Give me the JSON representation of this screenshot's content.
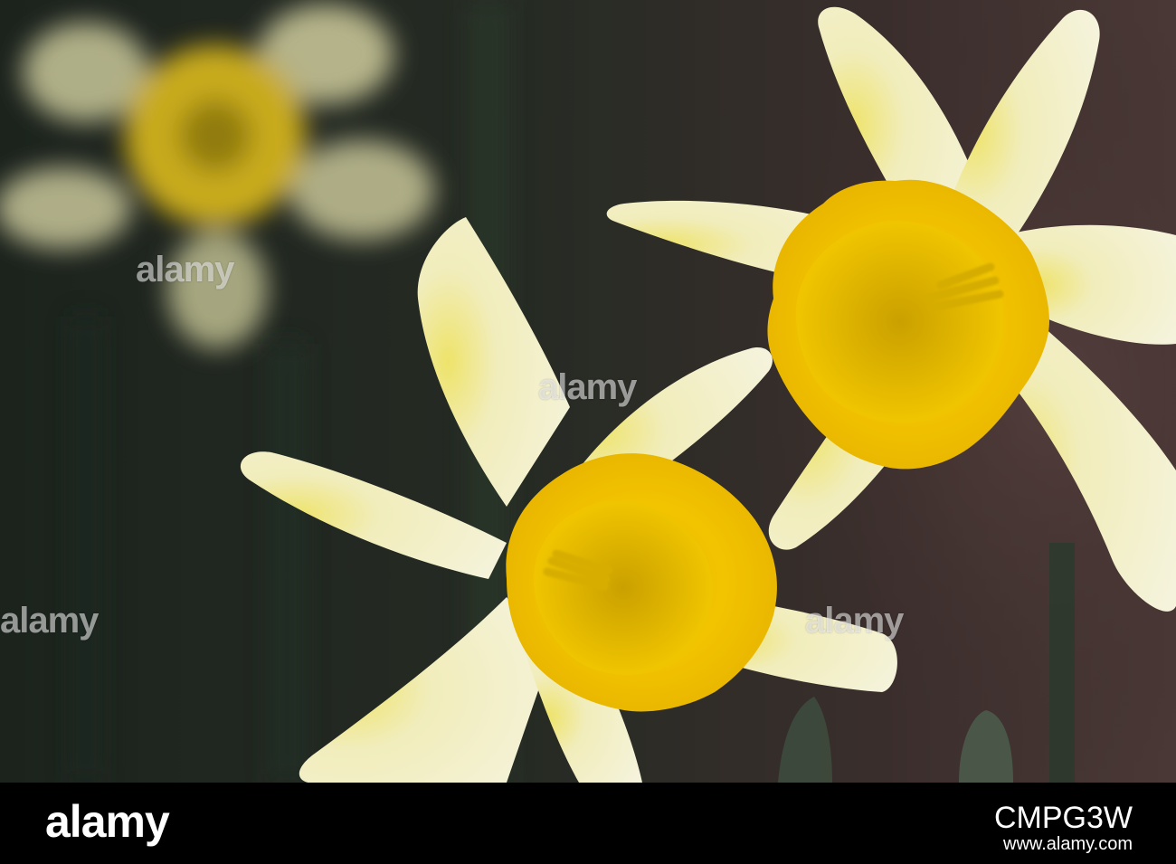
{
  "watermark": {
    "text": "alamy",
    "color": "#ffffff"
  },
  "footer": {
    "logo": "alamy",
    "image_id": "CMPG3W",
    "url": "www.alamy.com"
  },
  "colors": {
    "petal": "#f3f0cf",
    "corona": "#f2c200",
    "background_dark": "#1b211c",
    "background_warm": "#3a2a2a"
  }
}
